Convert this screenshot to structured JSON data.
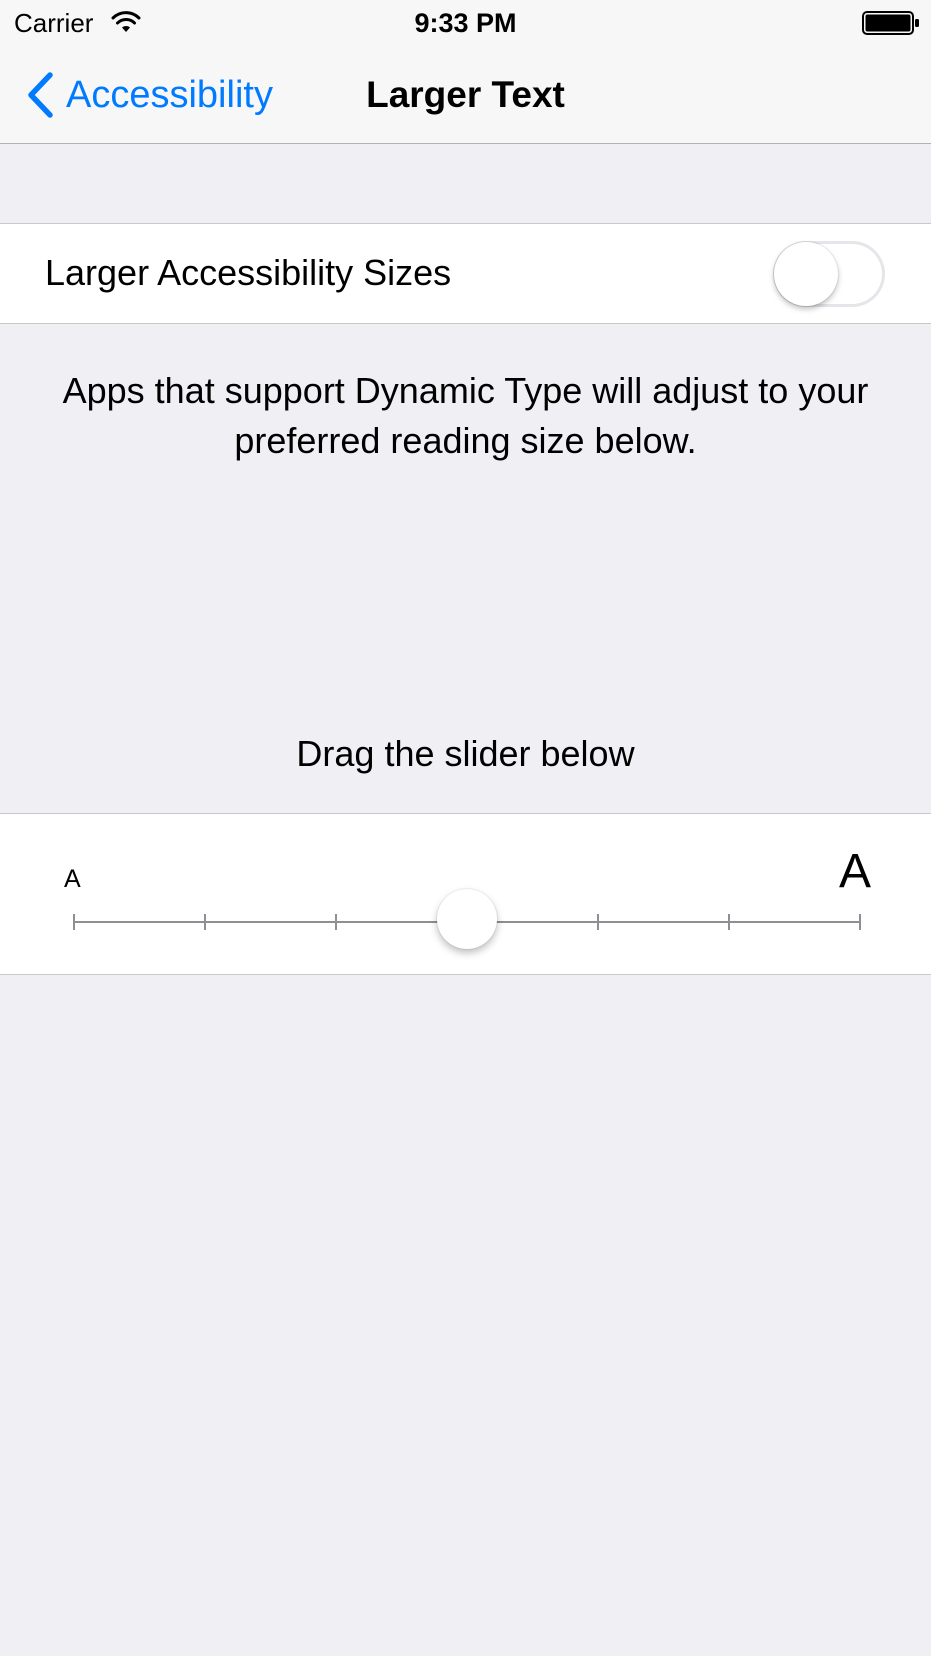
{
  "status_bar": {
    "carrier": "Carrier",
    "time": "9:33 PM",
    "icons": [
      "wifi-icon",
      "battery-icon"
    ]
  },
  "nav": {
    "back_label": "Accessibility",
    "title": "Larger Text",
    "accent_color": "#007aff"
  },
  "toggle_row": {
    "label": "Larger Accessibility Sizes",
    "state": "off"
  },
  "description": "Apps that support Dynamic Type will adjust to your preferred reading size below.",
  "instruction": "Drag the slider below",
  "slider": {
    "min_label": "A",
    "max_label": "A",
    "steps": 7,
    "current_step": 4
  }
}
